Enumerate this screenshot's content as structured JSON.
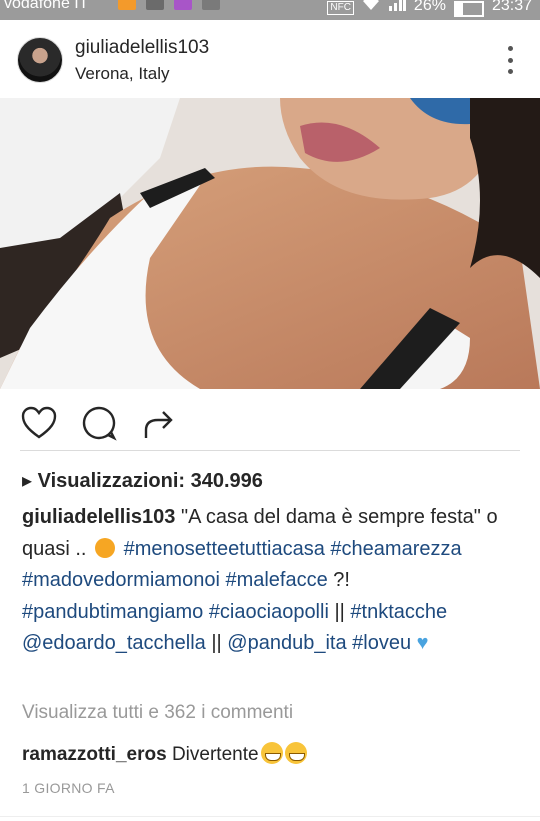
{
  "status_bar": {
    "carrier": "vodafone IT",
    "nfc": "NFC",
    "battery": "26%",
    "time": "23:37"
  },
  "post": {
    "username": "giuliadelellis103",
    "location": "Verona, Italy",
    "views_label": "Visualizzazioni:",
    "views_count": "340.996",
    "caption": {
      "user": "giuliadelellis103",
      "text1": " \"A casa del dama è sempre festa\" o quasi .. ",
      "tag1": "#menosetteetuttiacasa",
      "tag2": "#cheamarezza",
      "tag3": "#madovedormiamonoi",
      "tag4": "#malefacce",
      "text2": " ?! ",
      "tag5": "#pandubtimangiamo",
      "tag6": "#ciaociaopolli",
      "text3": " || ",
      "tag7": "#tnktacche",
      "mention1": "@edoardo_tacchella",
      "text4": " || ",
      "mention2": "@pandub_ita",
      "tag8": "#loveu"
    },
    "view_all_comments": "Visualizza tutti e 362 i commenti",
    "comment": {
      "user": "ramazzotti_eros",
      "text": "Divertente"
    },
    "timestamp": "1 GIORNO FA"
  },
  "icons": {
    "like": "heart-outline-icon",
    "comment": "speech-bubble-icon",
    "share": "share-arrow-icon",
    "menu": "more-vertical-icon"
  },
  "colors": {
    "hashtag": "#1e4a7e",
    "muted": "#999999",
    "status_bar": "#9b9b9b"
  }
}
